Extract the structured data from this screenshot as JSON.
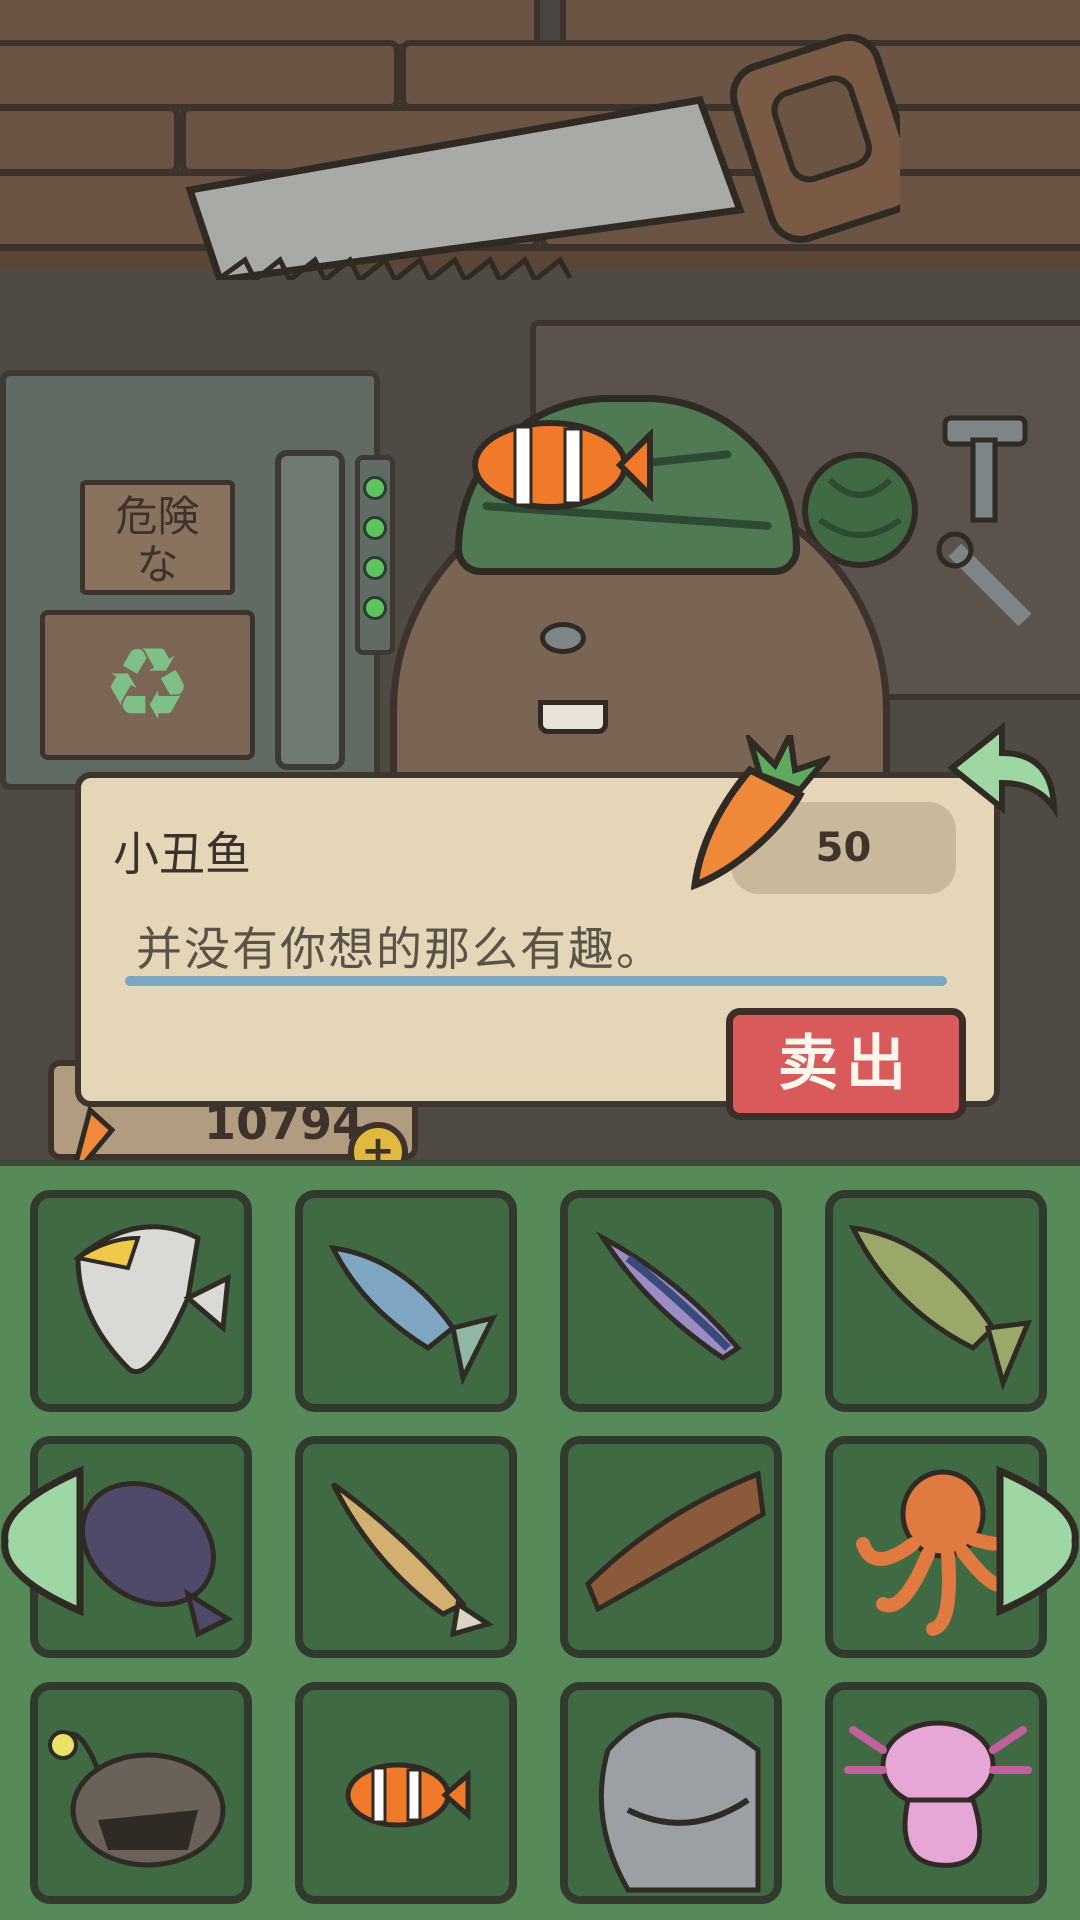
{
  "background": {
    "sign_text": "危険な"
  },
  "dialog": {
    "fish_name": "小丑鱼",
    "price": "50",
    "description": "并没有你想的那么有趣。",
    "sell_label": "卖出"
  },
  "currency": {
    "carrots": "10794"
  },
  "inventory": {
    "items": [
      {
        "name": "angelfish",
        "icon": "angelfish-icon"
      },
      {
        "name": "sardine",
        "icon": "sardine-icon"
      },
      {
        "name": "sandeel",
        "icon": "sandeel-icon"
      },
      {
        "name": "bass",
        "icon": "bass-icon"
      },
      {
        "name": "flounder",
        "icon": "flounder-icon"
      },
      {
        "name": "goby",
        "icon": "goby-icon"
      },
      {
        "name": "sea-cucumber",
        "icon": "sea-cucumber-icon"
      },
      {
        "name": "octopus",
        "icon": "octopus-icon"
      },
      {
        "name": "anglerfish",
        "icon": "anglerfish-icon"
      },
      {
        "name": "clownfish",
        "icon": "clownfish-icon"
      },
      {
        "name": "whale-shark",
        "icon": "whale-shark-icon"
      },
      {
        "name": "axolotl",
        "icon": "axolotl-icon"
      }
    ]
  },
  "colors": {
    "dialog_bg": "#e5d6b8",
    "sell_button": "#d85a5a",
    "inventory_bg": "#568a58",
    "slot_bg": "#3f6a43"
  }
}
